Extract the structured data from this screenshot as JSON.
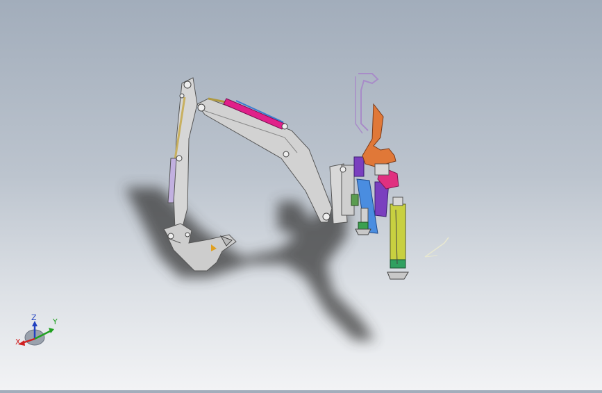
{
  "viewport": {
    "model": "backhoe-attachment-assembly",
    "background_colors": [
      "#a2adbb",
      "#f2f3f5"
    ]
  },
  "triad": {
    "x_label": "X",
    "y_label": "Y",
    "z_label": "Z",
    "colors": {
      "x": "#d02020",
      "y": "#20a020",
      "z": "#2040c0"
    }
  },
  "parts": [
    {
      "name": "boom",
      "color": "#cfcfcf"
    },
    {
      "name": "dipper-arm",
      "color": "#d4d4d4"
    },
    {
      "name": "bucket",
      "color": "#cccccc"
    },
    {
      "name": "boom-cylinder",
      "color": "#e0208a"
    },
    {
      "name": "dipper-cylinder",
      "color": "#a98fd0"
    },
    {
      "name": "bucket-cylinder-rod",
      "color": "#c8b060"
    },
    {
      "name": "seat-frame",
      "color": "#e07838"
    },
    {
      "name": "stabilizer-leg",
      "color": "#c8d040"
    },
    {
      "name": "swing-frame",
      "color": "#7a3fbf"
    },
    {
      "name": "swing-cylinder",
      "color": "#3a7bd0"
    },
    {
      "name": "control-lever",
      "color": "#b08ad0"
    }
  ]
}
